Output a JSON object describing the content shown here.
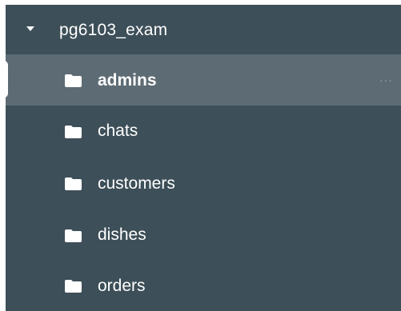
{
  "sidebar": {
    "database": {
      "name": "pg6103_exam",
      "expanded": true,
      "caret_icon": "caret-down-icon"
    },
    "collections": [
      {
        "label": "admins",
        "icon": "folder-icon",
        "selected": true
      },
      {
        "label": "chats",
        "icon": "folder-icon",
        "selected": false
      },
      {
        "label": "customers",
        "icon": "folder-icon",
        "selected": false
      },
      {
        "label": "dishes",
        "icon": "folder-icon",
        "selected": false
      },
      {
        "label": "orders",
        "icon": "folder-icon",
        "selected": false
      }
    ],
    "more_actions_label": "···",
    "colors": {
      "panel_bg": "#3d4f58",
      "selected_bg": "#5d6c74",
      "text": "#ffffff",
      "muted": "#9aa6ac"
    }
  }
}
